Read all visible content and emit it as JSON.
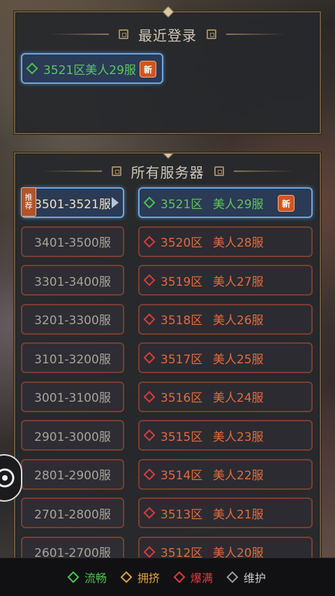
{
  "recent": {
    "title": "最近登录",
    "server": {
      "zone": "3521区",
      "name": "美人29服",
      "badge": "新"
    }
  },
  "all": {
    "title": "所有服务器",
    "ranges": [
      {
        "label": "3501-3521服",
        "badge": "推荐",
        "selected": true
      },
      {
        "label": "3401-3500服"
      },
      {
        "label": "3301-3400服"
      },
      {
        "label": "3201-3300服"
      },
      {
        "label": "3101-3200服"
      },
      {
        "label": "3001-3100服"
      },
      {
        "label": "2901-3000服"
      },
      {
        "label": "2801-2900服"
      },
      {
        "label": "2701-2800服"
      },
      {
        "label": "2601-2700服"
      }
    ],
    "servers": [
      {
        "zone": "3521区",
        "name": "美人29服",
        "status": "green",
        "badge": "新",
        "selected": true
      },
      {
        "zone": "3520区",
        "name": "美人28服",
        "status": "red"
      },
      {
        "zone": "3519区",
        "name": "美人27服",
        "status": "red"
      },
      {
        "zone": "3518区",
        "name": "美人26服",
        "status": "red"
      },
      {
        "zone": "3517区",
        "name": "美人25服",
        "status": "red"
      },
      {
        "zone": "3516区",
        "name": "美人24服",
        "status": "red"
      },
      {
        "zone": "3515区",
        "name": "美人23服",
        "status": "red"
      },
      {
        "zone": "3514区",
        "name": "美人22服",
        "status": "red"
      },
      {
        "zone": "3513区",
        "name": "美人21服",
        "status": "red"
      },
      {
        "zone": "3512区",
        "name": "美人20服",
        "status": "red"
      }
    ]
  },
  "legend": [
    {
      "label": "流畅",
      "color": "#4cc24a",
      "status": "green"
    },
    {
      "label": "拥挤",
      "color": "#e0a040",
      "status": "orange"
    },
    {
      "label": "爆满",
      "color": "#e03a3a",
      "status": "red"
    },
    {
      "label": "维护",
      "color": "#b0b0b0",
      "status": "grey"
    }
  ],
  "side_button": {
    "icon": "chat-icon"
  }
}
